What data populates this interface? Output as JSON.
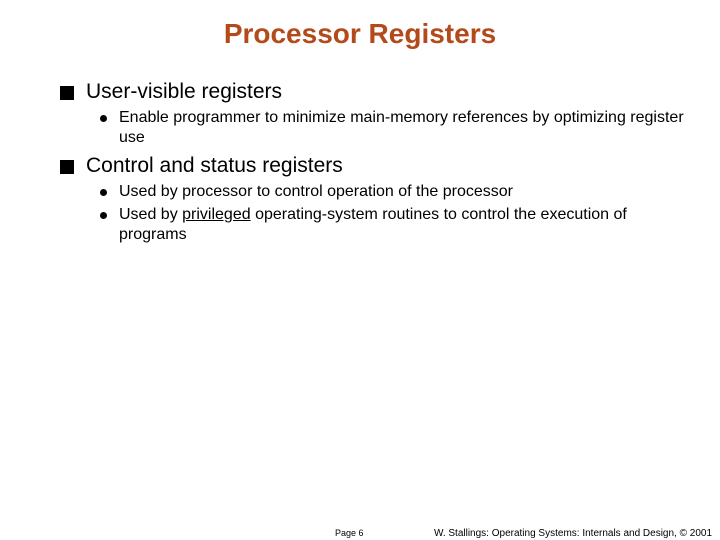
{
  "title": "Processor Registers",
  "items": [
    {
      "heading": "User-visible registers",
      "subs": [
        {
          "text": "Enable programmer to minimize main-memory references by optimizing register use"
        }
      ]
    },
    {
      "heading": "Control and status registers",
      "subs": [
        {
          "text": "Used by processor to control operation of the processor"
        },
        {
          "before": "Used by ",
          "underlined": "privileged",
          "after": " operating-system routines to control the execution of programs"
        }
      ]
    }
  ],
  "footer": {
    "page": "Page 6",
    "attribution": "W. Stallings: Operating Systems: Internals and Design, © 2001"
  }
}
